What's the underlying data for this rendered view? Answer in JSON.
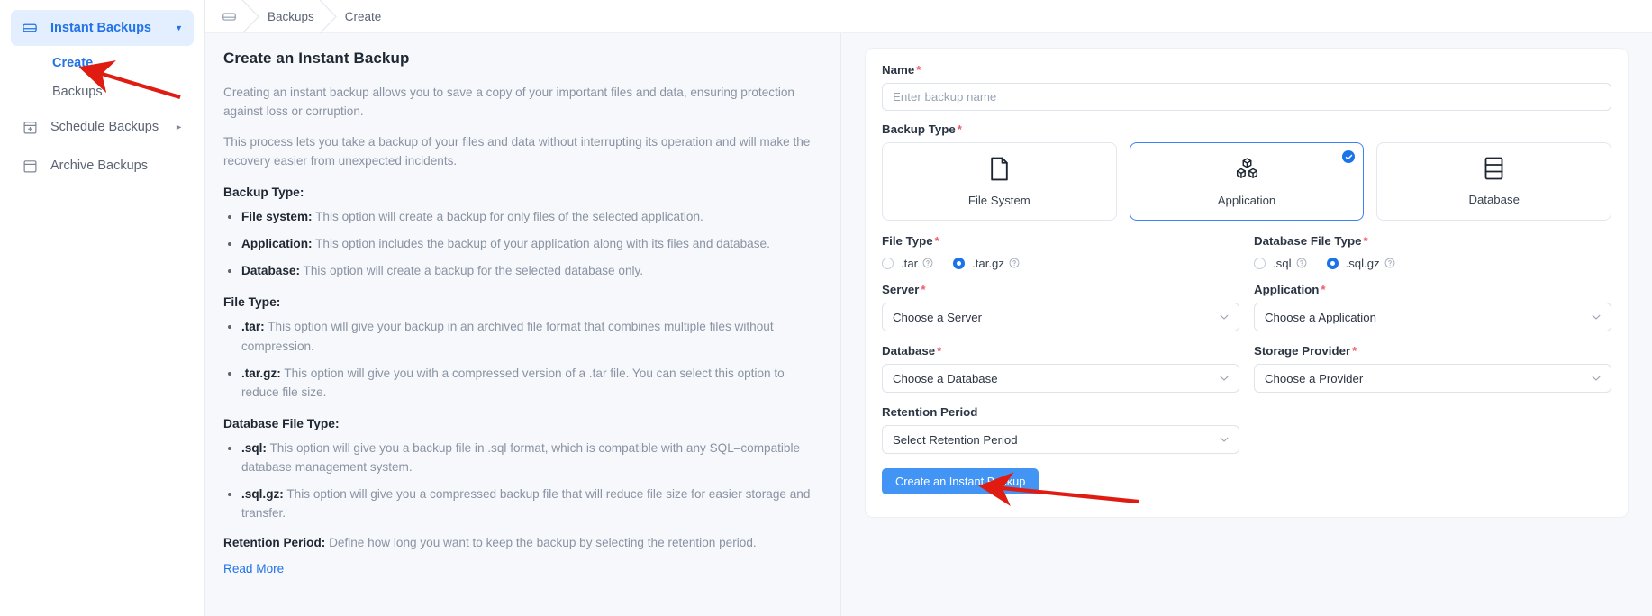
{
  "sidebar": {
    "items": [
      {
        "label": "Instant Backups",
        "icon": "backup-drive-icon",
        "active": true,
        "caret": "▼"
      },
      {
        "label": "Schedule Backups",
        "icon": "calendar-schedule-icon",
        "active": false,
        "caret": "►"
      },
      {
        "label": "Archive Backups",
        "icon": "archive-box-icon",
        "active": false,
        "caret": ""
      }
    ],
    "subitems": [
      {
        "label": "Create",
        "current": true
      },
      {
        "label": "Backups",
        "current": false
      }
    ]
  },
  "breadcrumb": {
    "home_icon": "backup-drive-icon",
    "items": [
      "Backups",
      "Create"
    ],
    "separator": "›"
  },
  "doc": {
    "title": "Create an Instant Backup",
    "intro1": "Creating an instant backup allows you to save a copy of your important files and data, ensuring protection against loss or corruption.",
    "intro2": "This process lets you take a backup of your files and data without interrupting its operation and will make the recovery easier from unexpected incidents.",
    "sections": [
      {
        "heading": "Backup Type:",
        "items": [
          {
            "term": "File system:",
            "desc": " This option will create a backup for only files of the selected application."
          },
          {
            "term": "Application:",
            "desc": " This option includes the backup of your application along with its files and database."
          },
          {
            "term": "Database:",
            "desc": " This option will create a backup for the selected database only."
          }
        ]
      },
      {
        "heading": "File Type:",
        "items": [
          {
            "term": ".tar:",
            "desc": " This option will give your backup in an archived file format that combines multiple files without compression."
          },
          {
            "term": ".tar.gz:",
            "desc": " This option will give you with a compressed version of a .tar file. You can select this option to reduce file size."
          }
        ]
      },
      {
        "heading": "Database File Type:",
        "items": [
          {
            "term": ".sql:",
            "desc": " This option will give you a backup file in .sql format, which is compatible with any SQL–compatible database management system."
          },
          {
            "term": ".sql.gz:",
            "desc": " This option will give you a compressed backup file that will reduce file size for easier storage and transfer."
          }
        ]
      }
    ],
    "retention_term": "Retention Period:",
    "retention_desc": " Define how long you want to keep the backup by selecting the retention period.",
    "read_more": "Read More"
  },
  "form": {
    "name": {
      "label": "Name",
      "required": "*",
      "value": "",
      "placeholder": "Enter backup name"
    },
    "backup_type": {
      "label": "Backup Type",
      "required": "*",
      "options": [
        {
          "label": "File System",
          "icon": "file-page-icon",
          "selected": false
        },
        {
          "label": "Application",
          "icon": "cubes-stack-icon",
          "selected": true,
          "check": "✔"
        },
        {
          "label": "Database",
          "icon": "database-rows-icon",
          "selected": false
        }
      ]
    },
    "file_type": {
      "label": "File Type",
      "required": "*",
      "options": [
        {
          "label": ".tar",
          "selected": false,
          "help": "?"
        },
        {
          "label": ".tar.gz",
          "selected": true,
          "help": "?"
        }
      ]
    },
    "database_file_type": {
      "label": "Database File Type",
      "required": "*",
      "options": [
        {
          "label": ".sql",
          "selected": false,
          "help": "?"
        },
        {
          "label": ".sql.gz",
          "selected": true,
          "help": "?"
        }
      ]
    },
    "server": {
      "label": "Server",
      "required": "*",
      "value": "Choose a Server"
    },
    "application": {
      "label": "Application",
      "required": "*",
      "value": "Choose a Application"
    },
    "database": {
      "label": "Database",
      "required": "*",
      "value": "Choose a Database"
    },
    "storage_provider": {
      "label": "Storage Provider",
      "required": "*",
      "value": "Choose a Provider"
    },
    "retention_period": {
      "label": "Retention Period",
      "required": "",
      "value": "Select Retention Period"
    },
    "submit_label": "Create an Instant Backup"
  },
  "colors": {
    "accent": "#2272e8",
    "button": "#4294f5",
    "selected_border": "#3b82f6",
    "required": "#f2596b",
    "annotation_arrow": "#e01b12",
    "sidebar_active_bg": "#e3eefe"
  }
}
